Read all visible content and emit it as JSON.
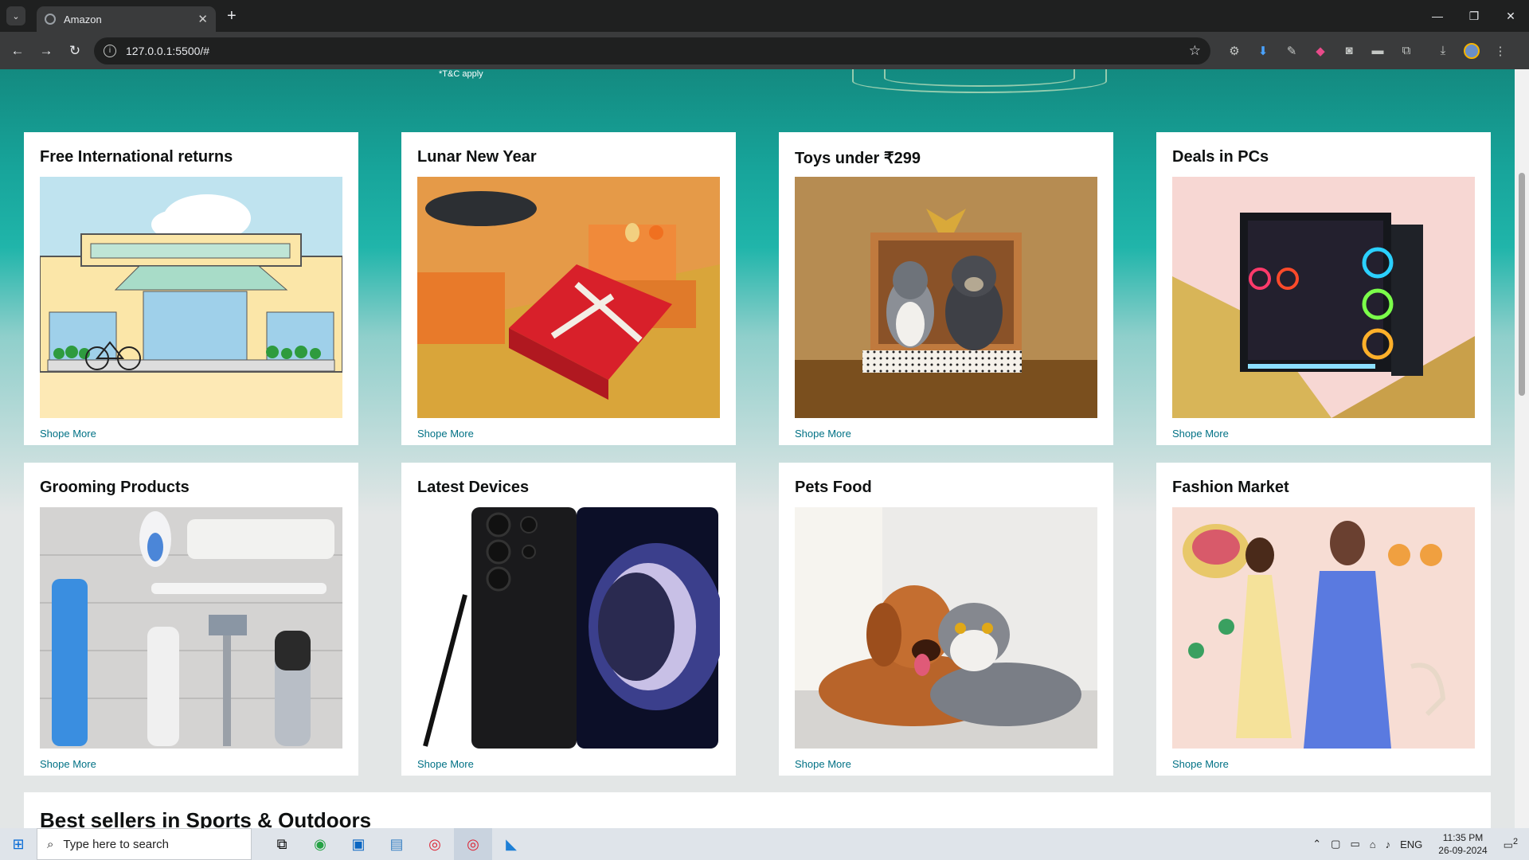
{
  "browser": {
    "tab_title": "Amazon",
    "url": "127.0.0.1:5500/#"
  },
  "hero": {
    "tnc": "*T&C apply"
  },
  "cards": [
    {
      "title": "Free International returns",
      "link": "Shope More"
    },
    {
      "title": "Lunar New Year",
      "link": "Shope More"
    },
    {
      "title": "Toys under ₹299",
      "link": "Shope More"
    },
    {
      "title": "Deals in PCs",
      "link": "Shope More"
    },
    {
      "title": "Grooming Products",
      "link": "Shope More"
    },
    {
      "title": "Latest Devices",
      "link": "Shope More"
    },
    {
      "title": "Pets Food",
      "link": "Shope More"
    },
    {
      "title": "Fashion Market",
      "link": "Shope More"
    }
  ],
  "best_sellers": {
    "title": "Best sellers in Sports & Outdoors"
  },
  "taskbar": {
    "search_placeholder": "Type here to search",
    "lang": "ENG",
    "time": "11:35 PM",
    "date": "26-09-2024",
    "notif_count": "2"
  }
}
